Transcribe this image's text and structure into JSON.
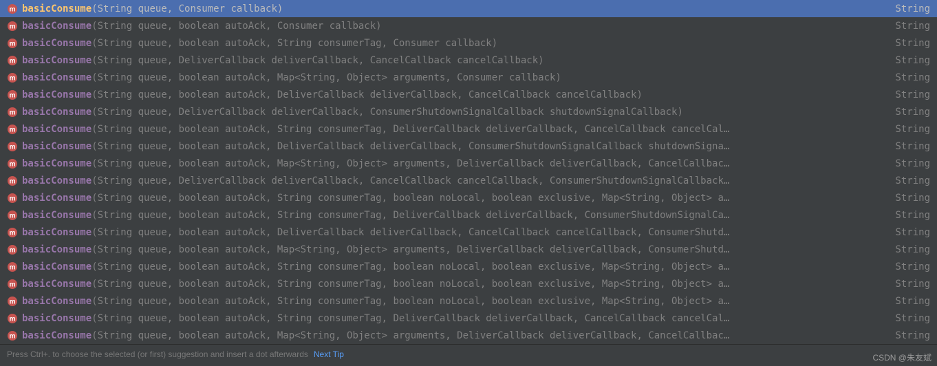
{
  "items": [
    {
      "name": "basicConsume",
      "params": "(String queue, Consumer callback)",
      "ret": "String",
      "selected": true
    },
    {
      "name": "basicConsume",
      "params": "(String queue, boolean autoAck, Consumer callback)",
      "ret": "String",
      "selected": false
    },
    {
      "name": "basicConsume",
      "params": "(String queue, boolean autoAck, String consumerTag, Consumer callback)",
      "ret": "String",
      "selected": false
    },
    {
      "name": "basicConsume",
      "params": "(String queue, DeliverCallback deliverCallback, CancelCallback cancelCallback)",
      "ret": "String",
      "selected": false
    },
    {
      "name": "basicConsume",
      "params": "(String queue, boolean autoAck, Map<String, Object> arguments, Consumer callback)",
      "ret": "String",
      "selected": false
    },
    {
      "name": "basicConsume",
      "params": "(String queue, boolean autoAck, DeliverCallback deliverCallback, CancelCallback cancelCallback)",
      "ret": "String",
      "selected": false
    },
    {
      "name": "basicConsume",
      "params": "(String queue, DeliverCallback deliverCallback, ConsumerShutdownSignalCallback shutdownSignalCallback)",
      "ret": "String",
      "selected": false
    },
    {
      "name": "basicConsume",
      "params": "(String queue, boolean autoAck, String consumerTag, DeliverCallback deliverCallback, CancelCallback cancelCal…",
      "ret": "String",
      "selected": false
    },
    {
      "name": "basicConsume",
      "params": "(String queue, boolean autoAck, DeliverCallback deliverCallback, ConsumerShutdownSignalCallback shutdownSigna…",
      "ret": "String",
      "selected": false
    },
    {
      "name": "basicConsume",
      "params": "(String queue, boolean autoAck, Map<String, Object> arguments, DeliverCallback deliverCallback, CancelCallbac…",
      "ret": "String",
      "selected": false
    },
    {
      "name": "basicConsume",
      "params": "(String queue, DeliverCallback deliverCallback, CancelCallback cancelCallback, ConsumerShutdownSignalCallback…",
      "ret": "String",
      "selected": false
    },
    {
      "name": "basicConsume",
      "params": "(String queue, boolean autoAck, String consumerTag, boolean noLocal, boolean exclusive, Map<String, Object> a…",
      "ret": "String",
      "selected": false
    },
    {
      "name": "basicConsume",
      "params": "(String queue, boolean autoAck, String consumerTag, DeliverCallback deliverCallback, ConsumerShutdownSignalCa…",
      "ret": "String",
      "selected": false
    },
    {
      "name": "basicConsume",
      "params": "(String queue, boolean autoAck, DeliverCallback deliverCallback, CancelCallback cancelCallback, ConsumerShutd…",
      "ret": "String",
      "selected": false
    },
    {
      "name": "basicConsume",
      "params": "(String queue, boolean autoAck, Map<String, Object> arguments, DeliverCallback deliverCallback, ConsumerShutd…",
      "ret": "String",
      "selected": false
    },
    {
      "name": "basicConsume",
      "params": "(String queue, boolean autoAck, String consumerTag, boolean noLocal, boolean exclusive, Map<String, Object> a…",
      "ret": "String",
      "selected": false
    },
    {
      "name": "basicConsume",
      "params": "(String queue, boolean autoAck, String consumerTag, boolean noLocal, boolean exclusive, Map<String, Object> a…",
      "ret": "String",
      "selected": false
    },
    {
      "name": "basicConsume",
      "params": "(String queue, boolean autoAck, String consumerTag, boolean noLocal, boolean exclusive, Map<String, Object> a…",
      "ret": "String",
      "selected": false
    },
    {
      "name": "basicConsume",
      "params": "(String queue, boolean autoAck, String consumerTag, DeliverCallback deliverCallback, CancelCallback cancelCal…",
      "ret": "String",
      "selected": false
    },
    {
      "name": "basicConsume",
      "params": "(String queue, boolean autoAck, Map<String, Object> arguments, DeliverCallback deliverCallback, CancelCallbac…",
      "ret": "String",
      "selected": false
    }
  ],
  "footer": {
    "hint": "Press Ctrl+. to choose the selected (or first) suggestion and insert a dot afterwards",
    "link": "Next Tip"
  },
  "watermark": "CSDN @朱友斌"
}
